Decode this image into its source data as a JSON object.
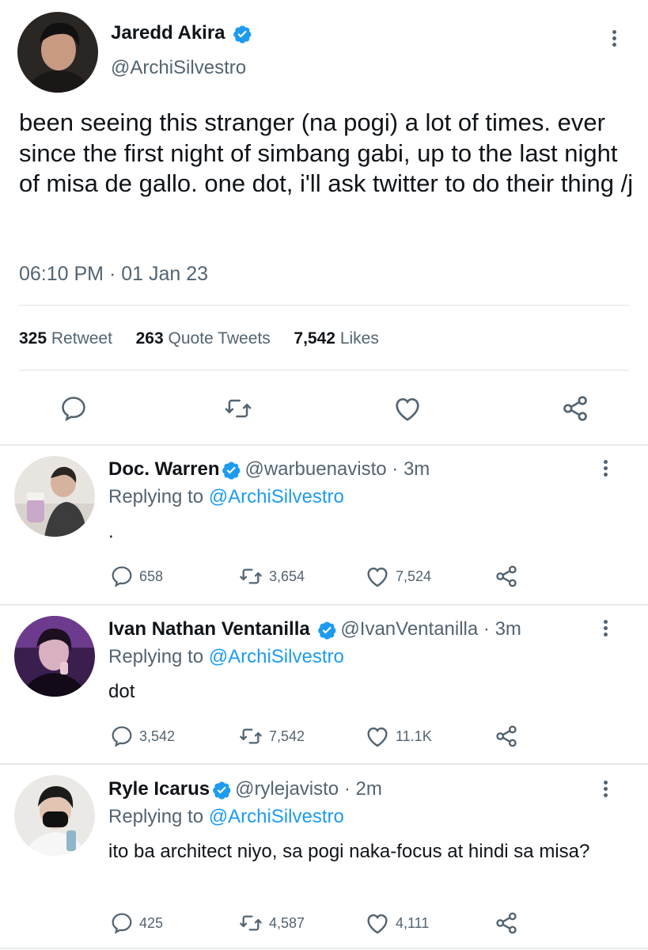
{
  "main_tweet": {
    "name": "Jaredd Akira",
    "handle": "@ArchiSilvestro",
    "text": "been seeing this stranger (na pogi) a lot of times. ever since the first night of simbang gabi, up to the last night of misa de gallo. one dot, i'll ask twitter to do their thing /j",
    "timestamp": "06:10 PM · 01 Jan 23",
    "retweets": "325",
    "retweets_label": "Retweet",
    "quotes": "263",
    "quotes_label": "Quote Tweets",
    "likes": "7,542",
    "likes_label": "Likes"
  },
  "replies": [
    {
      "name": "Doc. Warren",
      "handle": "@warbuenavisto",
      "time": "· 3m",
      "replying_prefix": "Replying to",
      "replying_to": "@ArchiSilvestro",
      "text": ".",
      "reply_count": "658",
      "retweet_count": "3,654",
      "like_count": "7,524"
    },
    {
      "name": "Ivan Nathan Ventanilla",
      "handle": "@IvanVentanilla",
      "time": "· 3m",
      "replying_prefix": "Replying to",
      "replying_to": "@ArchiSilvestro",
      "text": "dot",
      "reply_count": "3,542",
      "retweet_count": "7,542",
      "like_count": "11.1K"
    },
    {
      "name": "Ryle Icarus",
      "handle": "@rylejavisto",
      "time": "· 2m",
      "replying_prefix": "Replying to",
      "replying_to": "@ArchiSilvestro",
      "text": "ito ba architect niyo, sa pogi naka-focus at hindi sa misa?",
      "reply_count": "425",
      "retweet_count": "4,587",
      "like_count": "4,111"
    }
  ],
  "icons": {
    "verified": "verified-badge-icon",
    "more": "more-vertical-icon",
    "reply": "comment-icon",
    "retweet": "retweet-icon",
    "like": "heart-icon",
    "share": "share-icon"
  },
  "colors": {
    "accent": "#1d9bf0",
    "secondary_text": "#536471",
    "primary_text": "#0f1419"
  }
}
